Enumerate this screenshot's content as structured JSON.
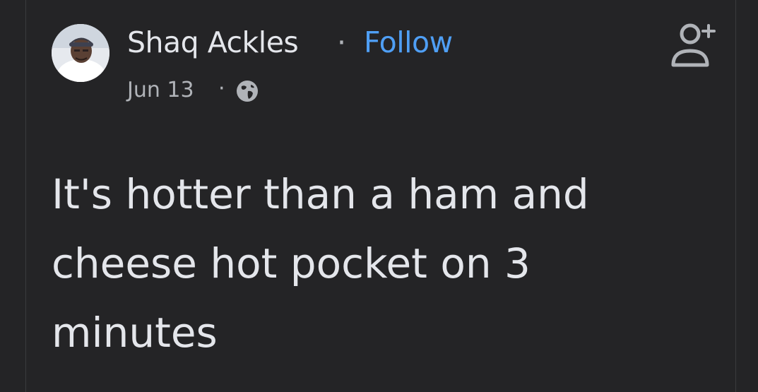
{
  "post": {
    "author_name": "Shaq Ackles",
    "separator": "·",
    "follow_label": "Follow",
    "date": "Jun 13",
    "meta_separator": "·",
    "audience_icon": "globe-icon",
    "add_friend_icon": "add-friend-icon",
    "body_text": "It's hotter than a ham and cheese hot pocket on 3 minutes"
  },
  "colors": {
    "background": "#242426",
    "primary_text": "#e4e6eb",
    "secondary_text": "#b0b3b8",
    "follow_link": "#4f9ff5"
  }
}
